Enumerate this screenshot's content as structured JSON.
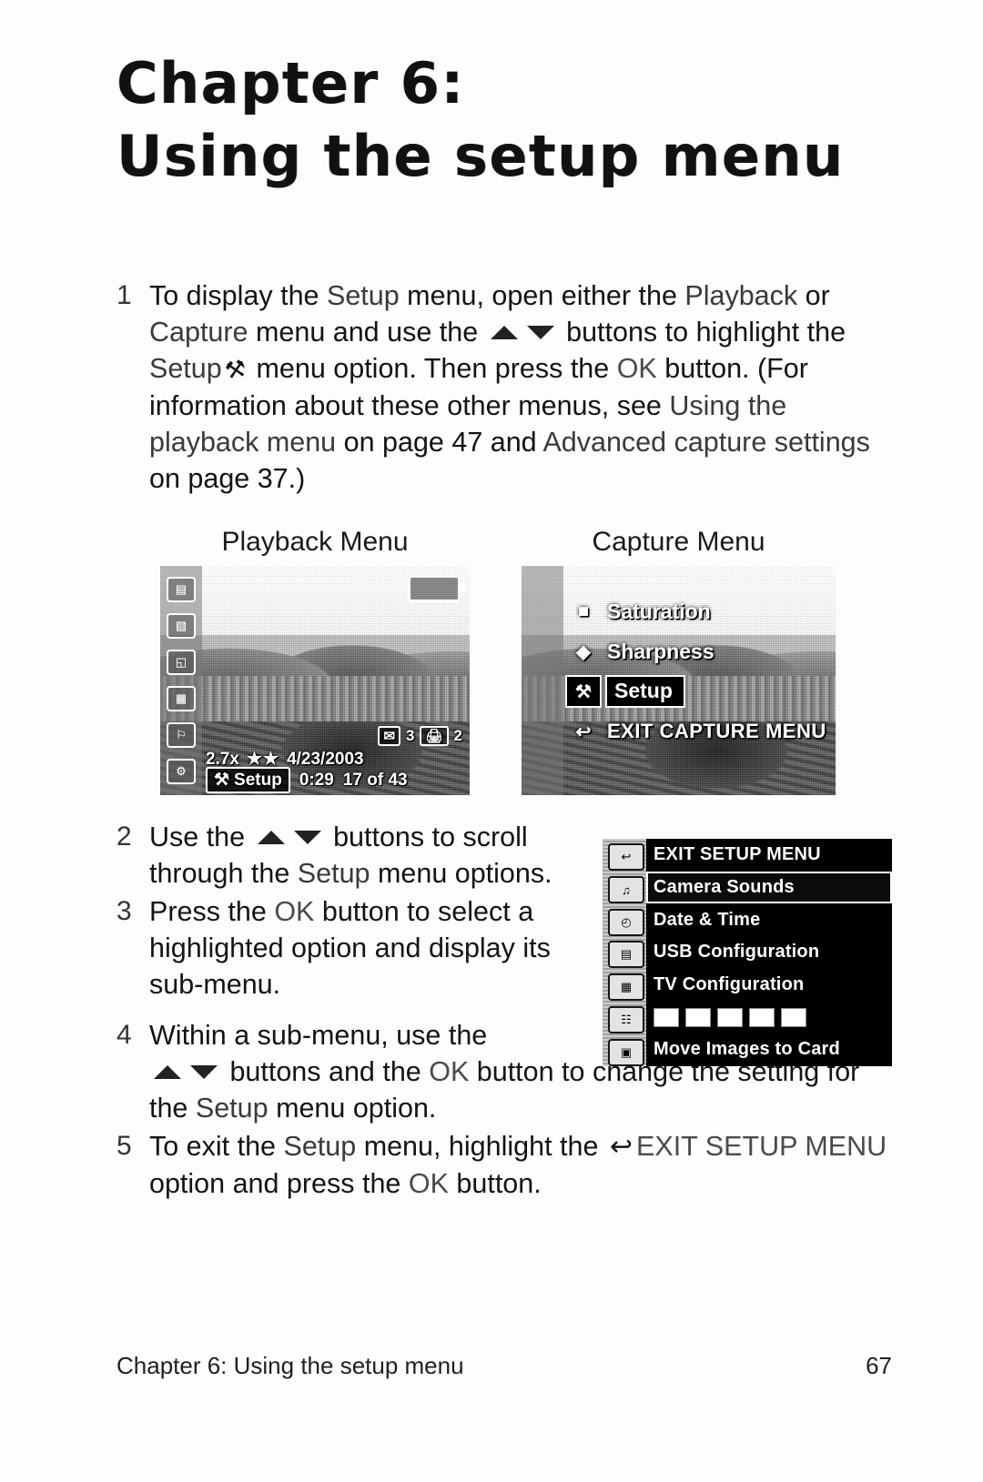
{
  "title": {
    "line1": "Chapter 6:",
    "line2": "Using the setup menu"
  },
  "steps": [
    {
      "num": "1",
      "seg1": "To display the ",
      "em1": "Setup",
      "seg2": " menu, open either the ",
      "em2": "Playback",
      "seg3": " or ",
      "em3": "Capture",
      "seg4": " menu and use the ",
      "seg5": " buttons to highlight the ",
      "em4": "Setup",
      "seg6": " menu option. Then press the ",
      "ok1": "OK",
      "seg7": " button. (For information about these other menus, see ",
      "em5": "Using the playback menu",
      "seg8": " on page 47 and ",
      "em6": "Advanced capture settings",
      "seg9": " on page 37.)"
    },
    {
      "num": "2",
      "seg1": "Use the ",
      "seg2": " buttons to scroll through the ",
      "em1": "Setup",
      "seg3": " menu options."
    },
    {
      "num": "3",
      "seg1": "Press the ",
      "ok1": "OK",
      "seg2": " button to select a highlighted option and display its sub-menu."
    },
    {
      "num": "4",
      "seg1": "Within a sub-menu, use the ",
      "seg2": " buttons and the ",
      "ok1": "OK",
      "seg3": " button to change the setting for the ",
      "em1": "Setup",
      "seg4": " menu option."
    },
    {
      "num": "5",
      "seg1": "To exit the ",
      "em1": "Setup",
      "seg2": " menu, highlight the ",
      "exit_label": "EXIT SETUP MENU",
      "seg3": " option and press the ",
      "ok1": "OK",
      "seg4": " button."
    }
  ],
  "figures": {
    "playback": {
      "caption": "Playback Menu",
      "rail_icons": [
        "▤",
        "▧",
        "◱",
        "▦",
        "⚐",
        "⚙"
      ],
      "overlay": {
        "mail_count": "3",
        "print_count": "2",
        "zoom": "2.7x",
        "stars": "★★",
        "date": "4/23/2003",
        "setup_label": "Setup",
        "time": "0:29",
        "index": "17 of 43"
      }
    },
    "capture": {
      "caption": "Capture Menu",
      "items": [
        {
          "label": "Saturation",
          "selected": false,
          "icon": "■"
        },
        {
          "label": "Sharpness",
          "selected": false,
          "icon": "◆"
        },
        {
          "label": "Setup",
          "selected": true,
          "icon": "⚒"
        },
        {
          "label": "EXIT CAPTURE MENU",
          "selected": false,
          "icon": "↩"
        }
      ]
    },
    "setup_menu": {
      "items": [
        {
          "label": "EXIT SETUP MENU",
          "selected": false,
          "icon": "↩",
          "type": "text"
        },
        {
          "label": "Camera Sounds",
          "selected": true,
          "icon": "♫",
          "type": "text"
        },
        {
          "label": "Date & Time",
          "selected": false,
          "icon": "◴",
          "type": "text"
        },
        {
          "label": "USB Configuration",
          "selected": false,
          "icon": "▤",
          "type": "text"
        },
        {
          "label": "TV Configuration",
          "selected": false,
          "icon": "▦",
          "type": "text"
        },
        {
          "label": "",
          "selected": false,
          "icon": "☷",
          "type": "language"
        },
        {
          "label": "Move Images to Card",
          "selected": false,
          "icon": "▣",
          "type": "text"
        }
      ],
      "language_chips": 5
    }
  },
  "footer": {
    "left": "Chapter 6: Using the setup menu",
    "right": "67"
  },
  "colors": {
    "ink": "#141414",
    "paper": "#fdfdfd",
    "lcd_dark": "#000000"
  }
}
